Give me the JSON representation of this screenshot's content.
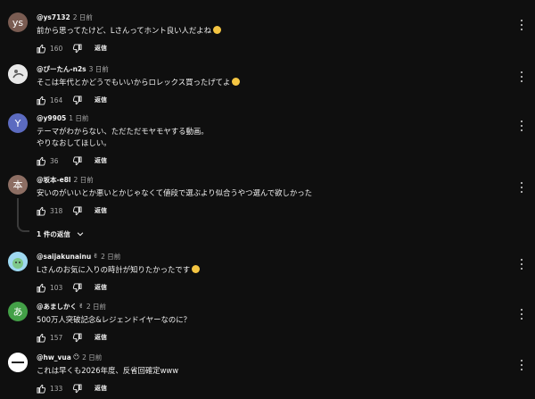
{
  "ui": {
    "reply_label": "返信",
    "more_icon": "more-vert-icon"
  },
  "comments": [
    {
      "avatar_text": "ys",
      "avatar_color": "#7a5c52",
      "handle": "@ys7132",
      "time": "2 日前",
      "text": [
        "前から思ってたけど、Lさんってホント良い人だよね"
      ],
      "emoji": "grinning-face-with-sweat",
      "likes": "160"
    },
    {
      "avatar_text": "",
      "avatar_color": "#e8e8e8",
      "handle": "@ぴーたん-n2s",
      "time": "3 日前",
      "text": [
        "そこは年代とかどうでもいいからロレックス買ったげてよ"
      ],
      "emoji": "smiling-face",
      "likes": "164"
    },
    {
      "avatar_text": "Y",
      "avatar_color": "#5c6bc0",
      "handle": "@y9905",
      "time": "1 日前",
      "text": [
        "テーマがわからない、ただただモヤモヤする動画。",
        "やりなおしてほしい。"
      ],
      "emoji": "",
      "likes": "36"
    },
    {
      "avatar_text": "本",
      "avatar_color": "#8d6e63",
      "handle": "@坂本-e8l",
      "time": "2 日前",
      "text": [
        "安いのがいいとか悪いとかじゃなくて値段で選ぶより似合うやつ選んで欲しかった"
      ],
      "emoji": "",
      "likes": "318"
    },
    {
      "avatar_text": "",
      "avatar_color": "#6ec3ea",
      "handle": "@saijakunainu",
      "time": "2 日前",
      "text": [
        "Lさんのお気に入りの時計が知りたかったです"
      ],
      "emoji": "slightly-smiling-face",
      "likes": "103",
      "badge": "✌"
    },
    {
      "avatar_text": "あ",
      "avatar_color": "#43a047",
      "handle": "@あましかく",
      "time": "2 日前",
      "text": [
        "500万人突破記念&レジェンドイヤーなのに？"
      ],
      "emoji": "",
      "likes": "157",
      "badge": "✌"
    },
    {
      "avatar_text": "",
      "avatar_color": "#ffffff",
      "handle": "@hw_vua",
      "time": "2 日前",
      "text": [
        "これは早くも2026年度、反省回確定www"
      ],
      "emoji": "",
      "likes": "133",
      "badge": "😶"
    }
  ],
  "replies_toggle": {
    "label": "1 件の返信"
  }
}
